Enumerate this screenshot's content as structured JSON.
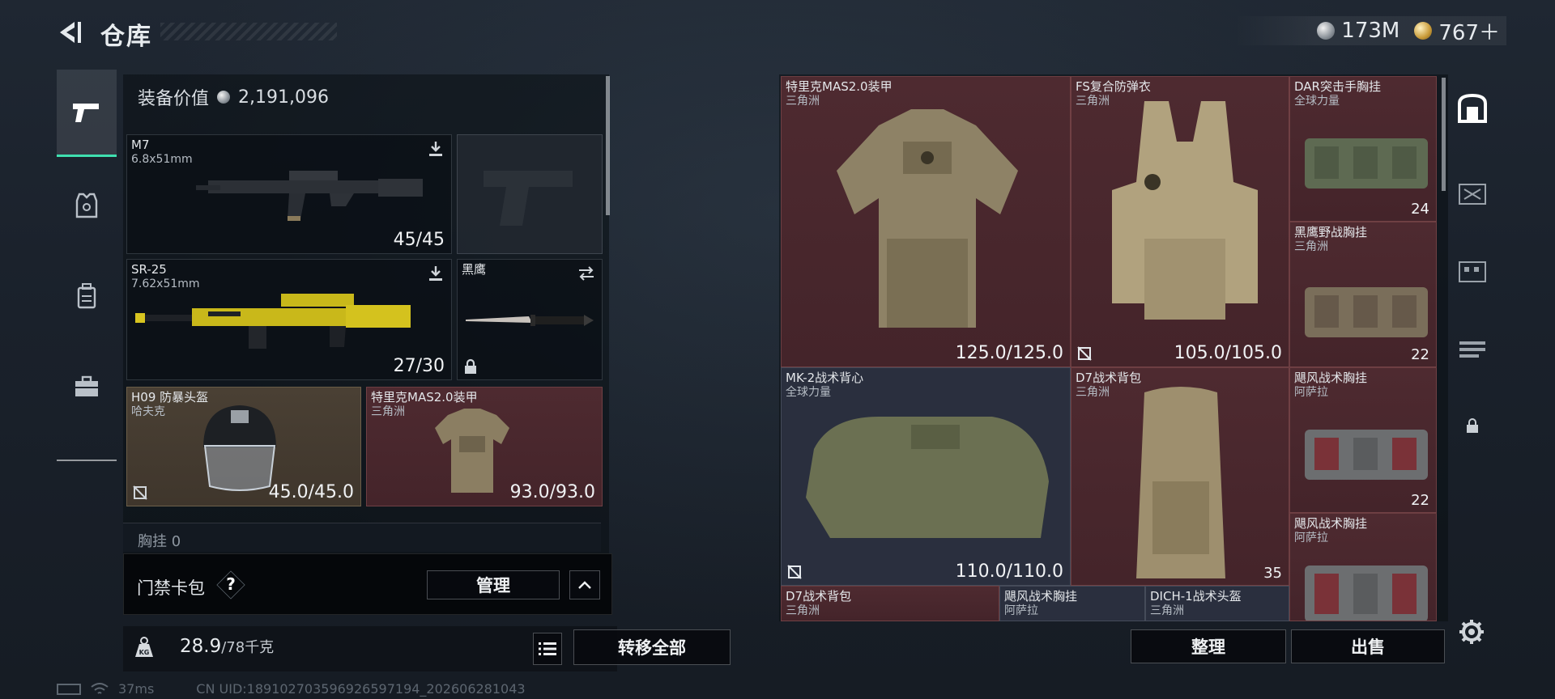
{
  "header": {
    "title": "仓库",
    "back_icon": "back-arrow-icon",
    "currencies": [
      {
        "icon": "silver-coin-icon",
        "value": "173M"
      },
      {
        "icon": "gold-coin-icon",
        "value": "767＋"
      }
    ]
  },
  "left_nav": [
    {
      "icon": "pistol-icon",
      "active": true
    },
    {
      "icon": "armor-icon",
      "active": false
    },
    {
      "icon": "backpack-icon",
      "active": false
    },
    {
      "icon": "briefcase-icon",
      "active": false
    }
  ],
  "loadout": {
    "equip_value_label": "装备价值",
    "equip_value": "2,191,096",
    "slots": {
      "primary": {
        "name": "M7",
        "sub": "6.8x51mm",
        "value": "45/45",
        "icon": "download-icon"
      },
      "sidearm": {
        "name": "",
        "sub": ""
      },
      "secondary": {
        "name": "SR-25",
        "sub": "7.62x51mm",
        "value": "27/30",
        "icon": "download-icon"
      },
      "melee": {
        "name": "黑鹰",
        "icon": "swap-icon",
        "lock_icon": "lock-icon"
      },
      "helmet": {
        "name": "H09 防暴头盔",
        "sub": "哈夫克",
        "value": "45.0/45.0",
        "icon": "no-repair-icon"
      },
      "armor": {
        "name": "特里克MAS2.0装甲",
        "sub": "三角洲",
        "value": "93.0/93.0"
      }
    },
    "chest_rig_label": "胸挂  0"
  },
  "keycard": {
    "label": "门禁卡包",
    "help": "?",
    "manage_label": "管理",
    "collapse_icon": "chevron-up-icon"
  },
  "weight": {
    "value": "28.9",
    "suffix": "/78千克",
    "icon": "kg-weight-icon",
    "transfer_label": "转移全部",
    "list_icon": "list-icon"
  },
  "footer": {
    "ping": "37ms",
    "uid": "CN UID:18910270359692659719​4_202606281043"
  },
  "stash": {
    "items": [
      {
        "name": "特里克MAS2.0装甲",
        "sub": "三角洲",
        "value": "125.0/125.0",
        "bg": "red"
      },
      {
        "name": "FS复合防弹衣",
        "sub": "三角洲",
        "value": "105.0/105.0",
        "bg": "red"
      },
      {
        "name": "DAR突击手胸挂",
        "sub": "全球力量",
        "value": "24",
        "bg": "red"
      },
      {
        "name": "黑鹰野战胸挂",
        "sub": "三角洲",
        "value": "22",
        "bg": "red"
      },
      {
        "name": "MK-2战术背心",
        "sub": "全球力量",
        "value": "110.0/110.0",
        "bg": "blue"
      },
      {
        "name": "D7战术背包",
        "sub": "三角洲",
        "value": "35",
        "bg": "red"
      },
      {
        "name": "飓风战术胸挂",
        "sub": "阿萨拉",
        "value": "22",
        "bg": "red"
      },
      {
        "name": "飓风战术胸挂",
        "sub": "阿萨拉",
        "value": "",
        "bg": "red"
      },
      {
        "name": "D7战术背包",
        "sub": "三角洲",
        "value": "",
        "bg": "red"
      },
      {
        "name": "飓风战术胸挂",
        "sub": "阿萨拉",
        "value": "",
        "bg": "blue"
      },
      {
        "name": "DICH-1战术头盔",
        "sub": "三角洲",
        "value": "",
        "bg": "blue"
      }
    ],
    "sort_label": "整理",
    "sell_label": "出售"
  },
  "right_side": [
    "safe-box-icon",
    "tool-box-icon",
    "building-icon",
    "weapon-rack-icon",
    "lock-icon"
  ],
  "colors": {
    "accent": "#3fe0b0",
    "red_bg": "#4e2a30",
    "blue_bg": "#2a2f3e"
  }
}
